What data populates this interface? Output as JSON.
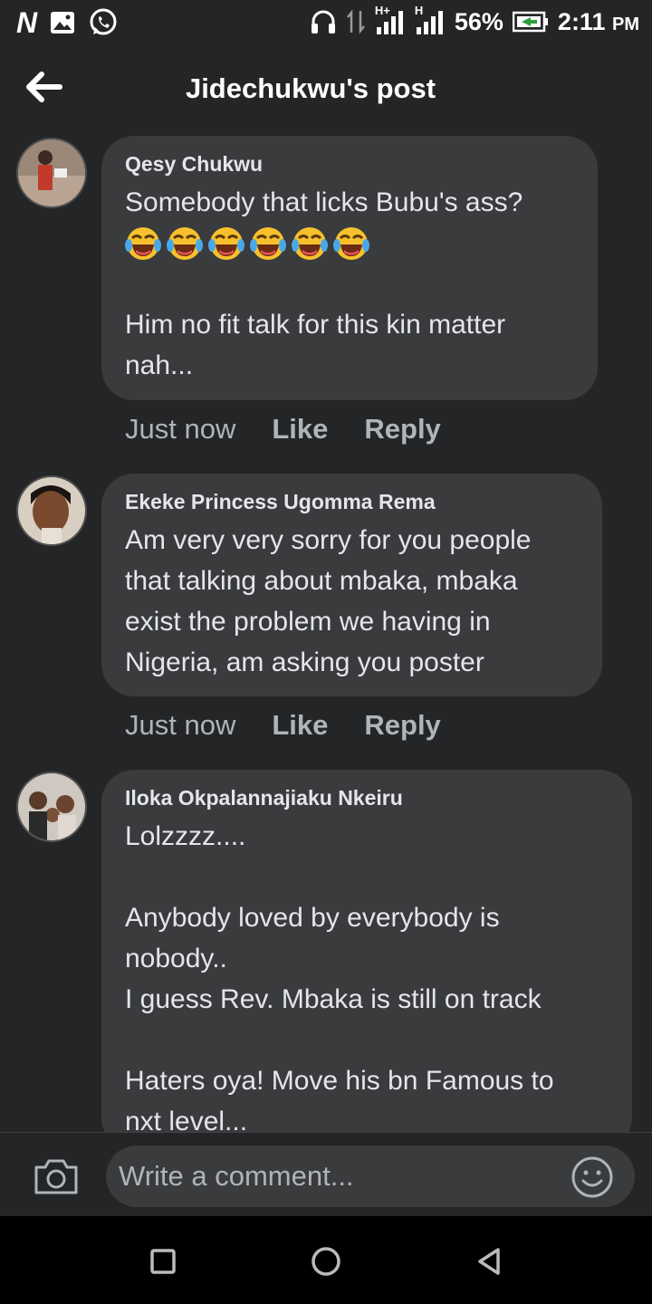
{
  "status_bar": {
    "app_letter": "N",
    "network_label_1": "H+",
    "network_label_2": "H",
    "battery": "56%",
    "time": "2:11",
    "ampm": "PM"
  },
  "header": {
    "title": "Jidechukwu's post"
  },
  "comments": [
    {
      "author": "Qesy Chukwu",
      "lines": [
        "Somebody that licks Bubu's ass?",
        "",
        "",
        "Him no fit talk for this kin matter",
        "nah..."
      ],
      "emoji_count": 6,
      "time": "Just now",
      "like": "Like",
      "reply": "Reply"
    },
    {
      "author": "Ekeke Princess Ugomma Rema",
      "lines": [
        "Am very very sorry for you people",
        "that talking about mbaka, mbaka",
        "exist the problem we having in",
        "Nigeria, am asking you poster"
      ],
      "time": "Just now",
      "like": "Like",
      "reply": "Reply"
    },
    {
      "author": "Iloka Okpalannajiaku Nkeiru",
      "lines": [
        "Lolzzzz....",
        "",
        "Anybody loved by everybody is",
        "nobody..",
        "I guess Rev. Mbaka is still on track",
        "",
        "Haters oya! Move his bn Famous to",
        "nxt level..."
      ]
    }
  ],
  "composer": {
    "placeholder": "Write a comment..."
  },
  "icons": {
    "emoji": "face-with-tears-of-joy",
    "accent": "#e4e6eb",
    "bubble_color": "#3a3b3c",
    "background": "#242526"
  }
}
